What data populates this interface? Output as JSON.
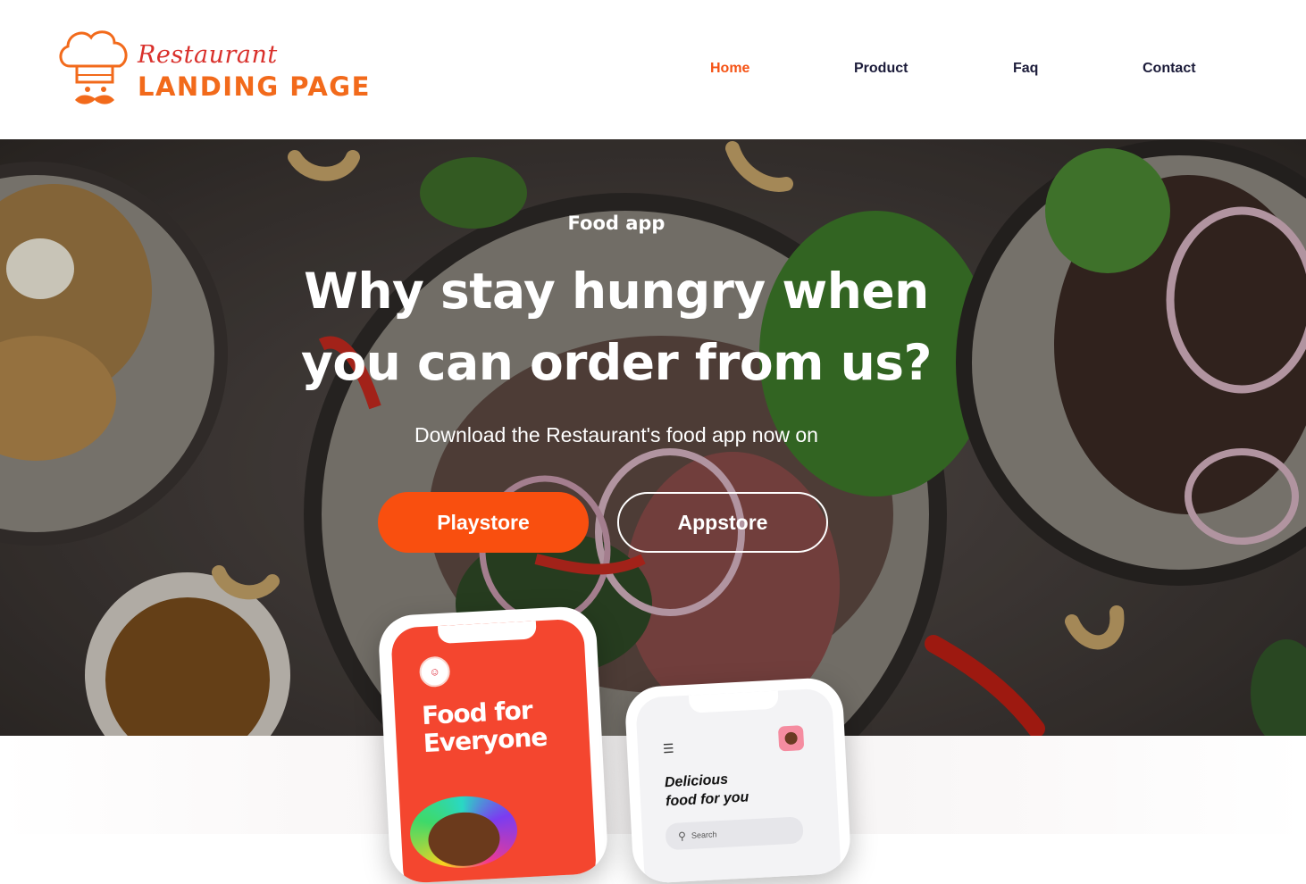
{
  "brand": {
    "script": "Restaurant",
    "main": "LANDING PAGE",
    "colors": {
      "script": "#d9302b",
      "main": "#f26a1b",
      "icon": "#f26a1b"
    }
  },
  "nav": {
    "items": [
      {
        "label": "Home",
        "active": true
      },
      {
        "label": "Product",
        "active": false
      },
      {
        "label": "Faq",
        "active": false
      },
      {
        "label": "Contact",
        "active": false
      }
    ],
    "active_color": "#f55315",
    "color": "#1c1c3a"
  },
  "hero": {
    "eyebrow": "Food app",
    "headline_line1": "Why stay hungry when",
    "headline_line2": "you can order from us?",
    "subtitle": "Download the Restaurant's food app now on",
    "primary_button": "Playstore",
    "secondary_button": "Appstore",
    "primary_color": "#f94f0f"
  },
  "phones": {
    "left": {
      "title_line1": "Food for",
      "title_line2": "Everyone",
      "screen_color": "#f4462f",
      "avatar_icon": "chef-avatar-icon"
    },
    "right": {
      "menu_icon": "hamburger-menu-icon",
      "title_line1": "Delicious",
      "title_line2": "food for you",
      "search_placeholder": "Search",
      "search_icon": "search-icon"
    }
  }
}
